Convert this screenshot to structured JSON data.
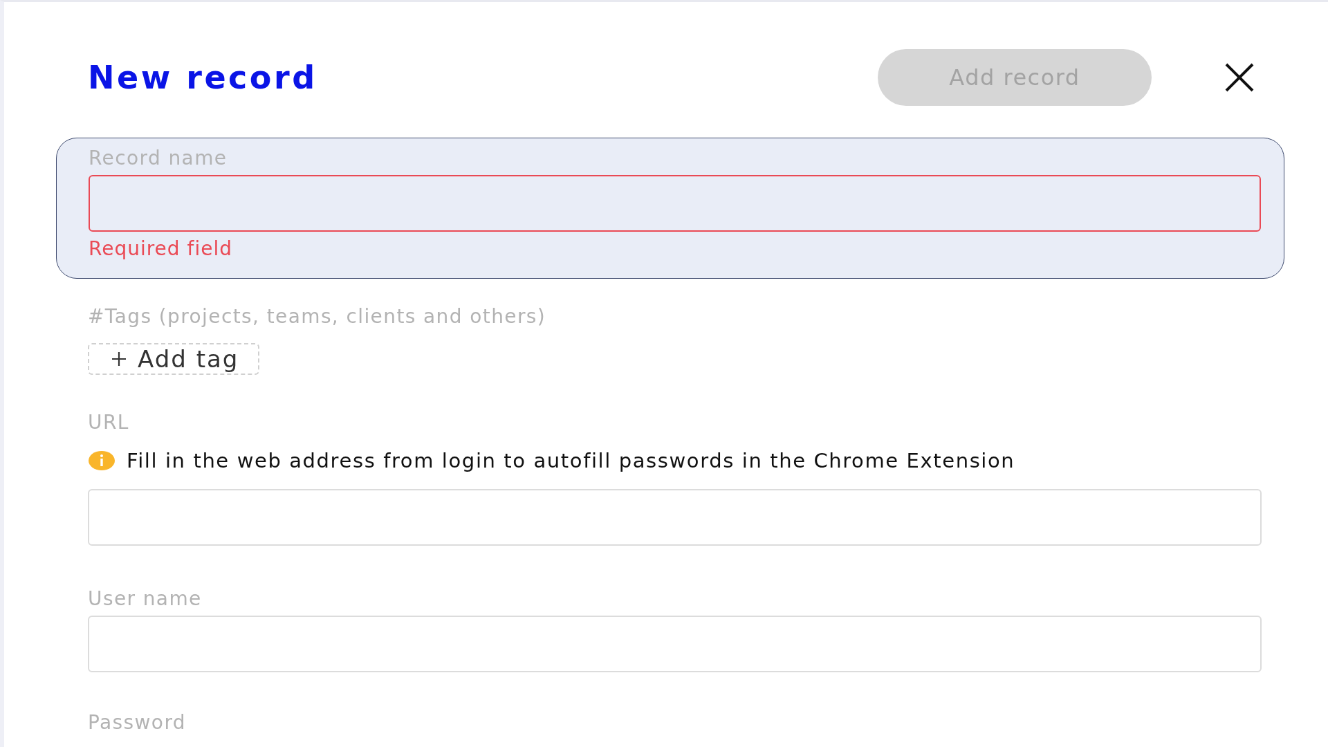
{
  "title": "New record",
  "add_button": {
    "label": "Add record",
    "disabled": true
  },
  "fields": [
    {
      "kind": "input",
      "label": "Record name",
      "focused": true,
      "invalid": true,
      "message": "Required field"
    },
    {
      "kind": "tags",
      "label": "#Tags (projects, teams, clients and others)",
      "button": "Add tag"
    },
    {
      "kind": "input",
      "label": "URL",
      "focused": false,
      "invalid": false,
      "hint": "Fill in the web address from login to autofill passwords in the Chrome Extension"
    },
    {
      "kind": "input",
      "label": "User name",
      "focused": false,
      "invalid": false
    },
    {
      "kind": "caption",
      "label": "Password"
    }
  ]
}
